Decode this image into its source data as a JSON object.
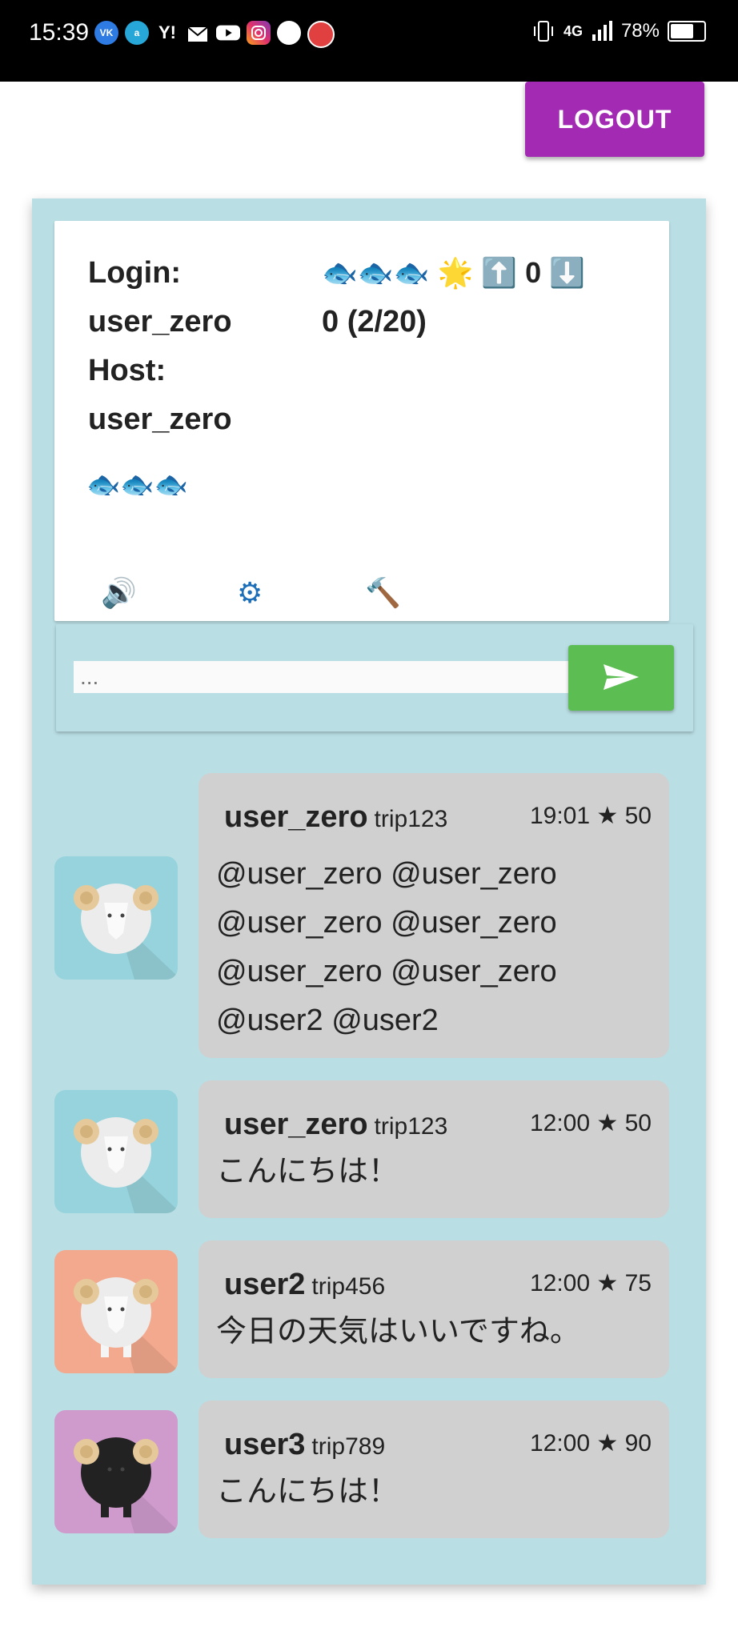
{
  "status_bar": {
    "time": "15:39",
    "network": "4G",
    "battery": "78%",
    "battery_level": 0.78,
    "notification_icons": [
      "vk-icon",
      "alexa-icon",
      "yahoo-icon",
      "mail-icon",
      "youtube-icon",
      "instagram-icon",
      "circle-icon",
      "app-icon"
    ]
  },
  "header": {
    "logout_label": "LOGOUT"
  },
  "info": {
    "login_label": "Login:",
    "login_user": "user_zero",
    "host_label": "Host:",
    "host_user": "user_zero",
    "fish_row": "🐟🐟🐟",
    "status_emojis": "🐟🐟🐟 🌟 ⬆️",
    "score": "0",
    "down_emoji": "⬇️",
    "counter": "0 (2/20)",
    "controls": [
      "speaker-icon",
      "settings-icon",
      "hammer-icon"
    ]
  },
  "composer": {
    "placeholder": "...",
    "send_color": "#5cbe52"
  },
  "messages": [
    {
      "user": "user_zero",
      "trip": "trip123",
      "time": "19:01",
      "stars": "★ 50",
      "lines": [
        "@user_zero @user_zero",
        "@user_zero @user_zero",
        "@user_zero @user_zero",
        "@user2 @user2"
      ],
      "avatar_bg": "#97d3dc",
      "sheep": "white"
    },
    {
      "user": "user_zero",
      "trip": "trip123",
      "time": "12:00",
      "stars": "★ 50",
      "lines": [
        "こんにちは！"
      ],
      "avatar_bg": "#97d3dc",
      "sheep": "white"
    },
    {
      "user": "user2",
      "trip": "trip456",
      "time": "12:00",
      "stars": "★ 75",
      "lines": [
        "今日の天気はいいですね。"
      ],
      "avatar_bg": "#f2a98e",
      "sheep": "white-legs"
    },
    {
      "user": "user3",
      "trip": "trip789",
      "time": "12:00",
      "stars": "★ 90",
      "lines": [
        "こんにちは！"
      ],
      "avatar_bg": "#cf9bcd",
      "sheep": "black"
    }
  ],
  "colors": {
    "panel": "#b9dee4",
    "logout": "#a32bb4",
    "bubble": "#d0d0d0"
  }
}
